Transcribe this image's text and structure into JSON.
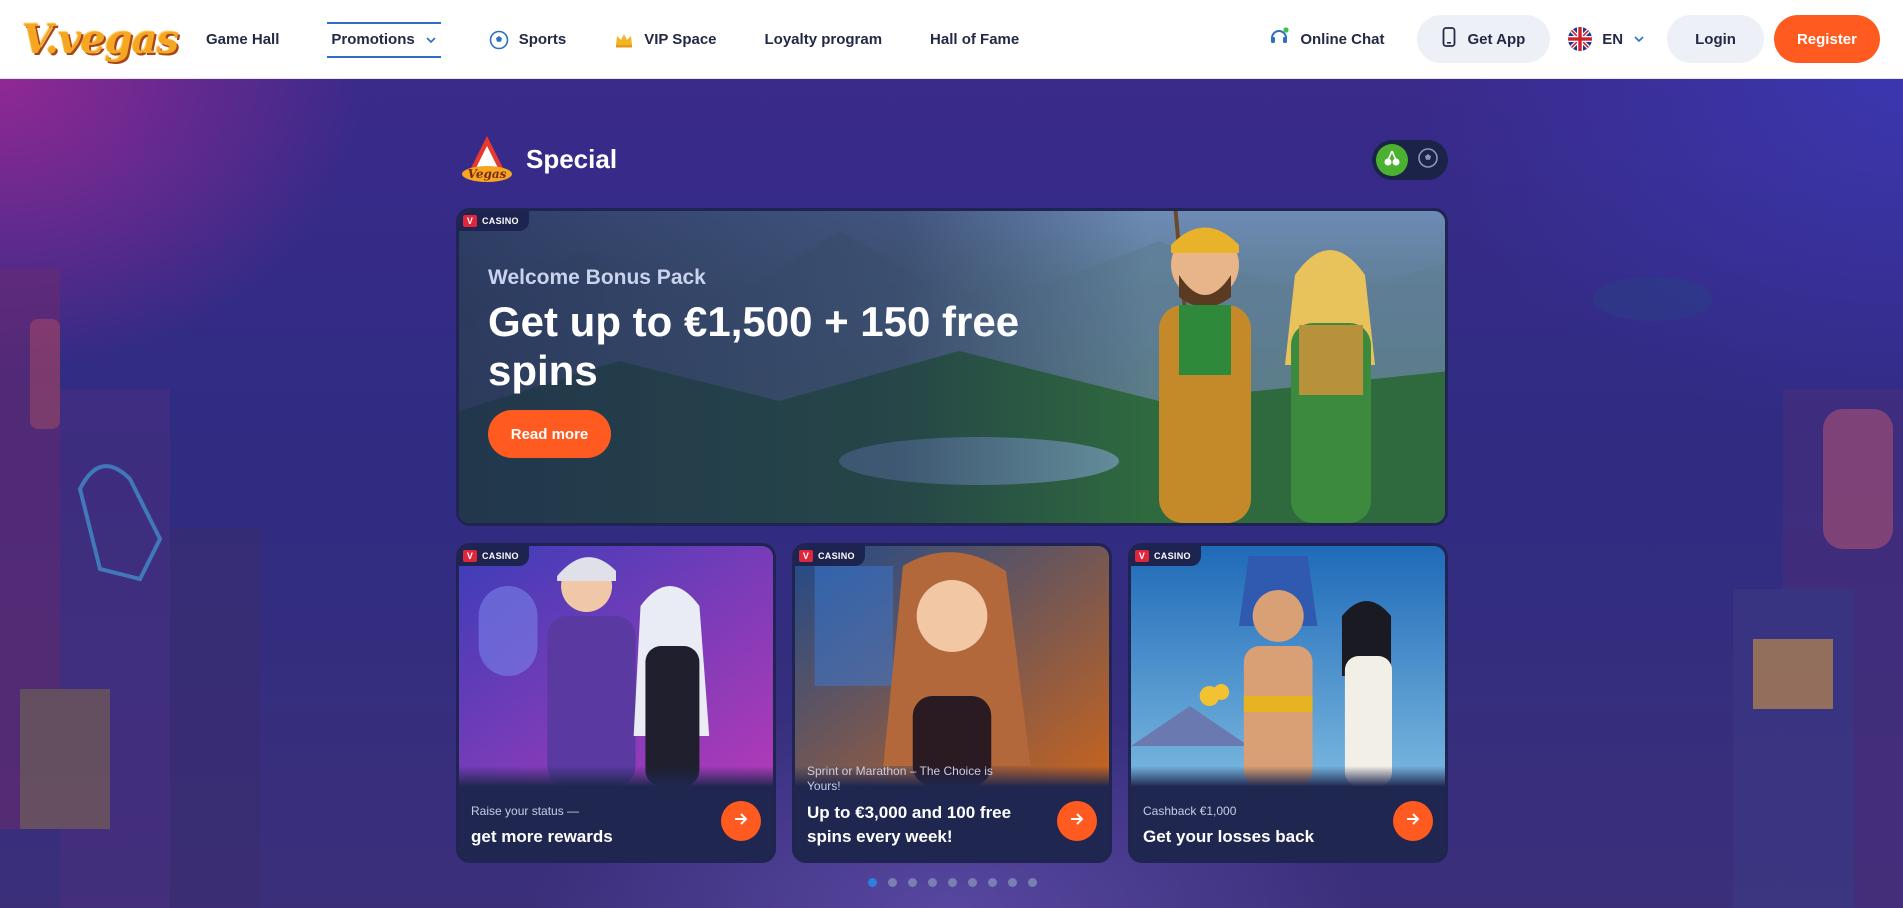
{
  "header": {
    "logo_text": "V.vegas",
    "nav": [
      {
        "label": "Game Hall",
        "icon": ""
      },
      {
        "label": "Promotions",
        "icon": "chevron-down-icon",
        "active": true
      },
      {
        "label": "Sports",
        "icon": "soccer-ball-icon"
      },
      {
        "label": "VIP Space",
        "icon": "crown-icon"
      },
      {
        "label": "Loyalty program",
        "icon": ""
      },
      {
        "label": "Hall of Fame",
        "icon": ""
      }
    ],
    "online_chat": "Online Chat",
    "get_app": "Get App",
    "language": "EN",
    "login": "Login",
    "register": "Register"
  },
  "section": {
    "title": "Special",
    "filters": [
      "casino-cherries-icon",
      "sports-ball-icon"
    ],
    "active_filter": "casino-cherries-icon"
  },
  "hero": {
    "tag": "CASINO",
    "subtitle": "Welcome Bonus Pack",
    "title": "Get up to €1,500 + 150 free spins",
    "cta": "Read more"
  },
  "cards": [
    {
      "tag": "CASINO",
      "small": "Raise your status —",
      "big": "get more rewards"
    },
    {
      "tag": "CASINO",
      "small": "Sprint or Marathon – The Choice is Yours!",
      "big": "Up to €3,000 and 100 free spins every week!"
    },
    {
      "tag": "CASINO",
      "small": "Cashback €1,000",
      "big": "Get your losses back"
    }
  ],
  "pagination": {
    "total": 9,
    "current": 1
  },
  "colors": {
    "accent": "#ff5a1f",
    "nav_active": "#2c6fc5",
    "toggle_on": "#4cb031",
    "card_bg": "#1f2750"
  }
}
